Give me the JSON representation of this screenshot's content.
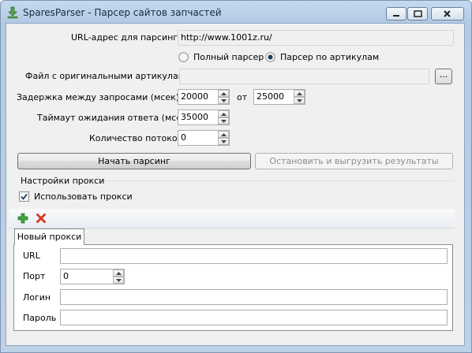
{
  "window": {
    "title": "SparesParser - Парсер сайтов запчастей",
    "icons": {
      "app": "download-arrow-icon",
      "minimize": "minimize-icon",
      "maximize": "maximize-icon",
      "close": "close-icon"
    }
  },
  "form": {
    "url_label": "URL-адрес для парсинга",
    "url_value": "http://www.1001z.ru/",
    "mode_full_label": "Полный парсер",
    "mode_articles_label": "Парсер по артикулам",
    "selected_mode": "articles",
    "file_label": "Файл с оригинальными артикулами",
    "file_value": "",
    "browse_label": "...",
    "delay_label": "Задержка между запросами (мсек) от",
    "delay_from": "20000",
    "delay_to_label": "от",
    "delay_to": "25000",
    "timeout_label": "Таймаут ожидания ответа (мсек)",
    "timeout_value": "35000",
    "threads_label": "Количество потоков",
    "threads_value": "0",
    "start_button": "Начать парсинг",
    "stop_button": "Остановить и выгрузить результаты"
  },
  "proxy": {
    "group_title": "Настройки прокси",
    "use_proxy_label": "Использовать прокси",
    "use_proxy_checked": true,
    "toolbar": {
      "add_icon": "plus-icon",
      "remove_icon": "red-x-icon"
    },
    "tab_label": "Новый прокси",
    "url_label": "URL",
    "url_value": "",
    "port_label": "Порт",
    "port_value": "0",
    "login_label": "Логин",
    "login_value": "",
    "password_label": "Пароль",
    "password_value": ""
  },
  "colors": {
    "titlebar": "#bcd2ea",
    "client": "#f0f0f0",
    "add_green": "#3aa53a",
    "remove_red": "#d83a2a"
  }
}
